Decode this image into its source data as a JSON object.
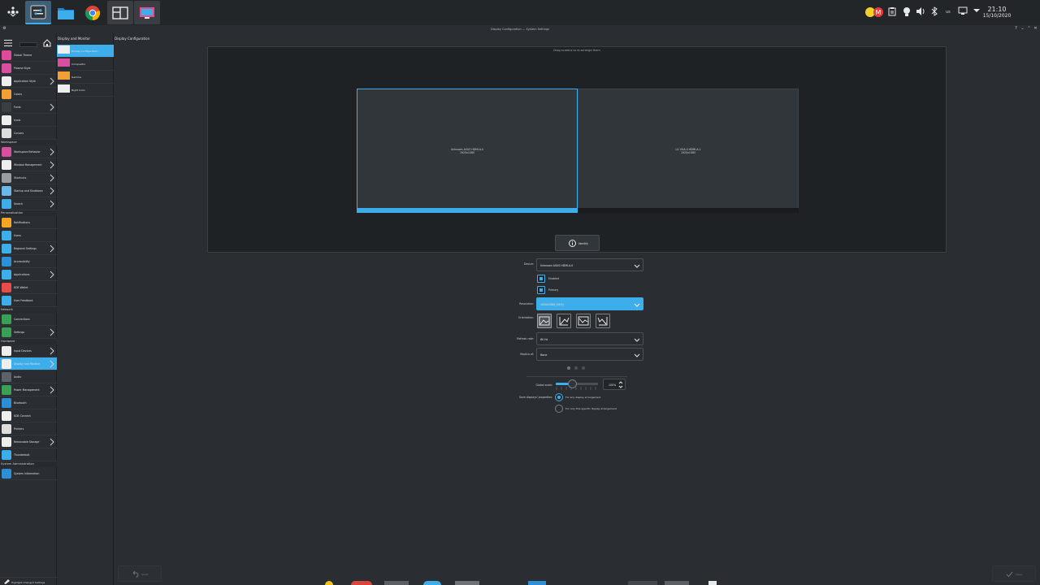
{
  "window": {
    "title": "Display Configuration — System Settings"
  },
  "panel": {
    "time": "21:10",
    "date": "15/10/2020",
    "keyboard_layout": "us",
    "notifications_badge": "M",
    "accent": "#3daee9"
  },
  "sidebar": {
    "items": [
      {
        "label": "Global Theme",
        "icon": "global-theme-icon",
        "chev": false,
        "color": "#e04a9a"
      },
      {
        "label": "Plasma Style",
        "icon": "plasma-style-icon",
        "chev": false,
        "color": "#d84fa0"
      },
      {
        "label": "Application Style",
        "icon": "application-style-icon",
        "chev": true,
        "color": "#eeeeee"
      },
      {
        "label": "Colors",
        "icon": "colors-icon",
        "chev": false,
        "color": "#f2a035"
      },
      {
        "label": "Fonts",
        "icon": "fonts-icon",
        "chev": true,
        "color": "#3a3f44"
      },
      {
        "label": "Icons",
        "icon": "icons-icon",
        "chev": false,
        "color": "#eeeeee"
      },
      {
        "label": "Cursors",
        "icon": "cursors-icon",
        "chev": false,
        "color": "#dddddd"
      }
    ],
    "sections": [
      {
        "title": "Workspace",
        "items": [
          {
            "label": "Workspace Behavior",
            "icon": "workspace-behavior-icon",
            "chev": true,
            "color": "#d84fa0"
          },
          {
            "label": "Window Management",
            "icon": "window-management-icon",
            "chev": true,
            "color": "#eeeeee"
          },
          {
            "label": "Shortcuts",
            "icon": "shortcuts-icon",
            "chev": true,
            "color": "#9a9ea2"
          },
          {
            "label": "Startup and Shutdown",
            "icon": "startup-shutdown-icon",
            "chev": true,
            "color": "#6cb8e8"
          },
          {
            "label": "Search",
            "icon": "search-icon",
            "chev": true,
            "color": "#3daee9"
          }
        ]
      },
      {
        "title": "Personalization",
        "items": [
          {
            "label": "Notifications",
            "icon": "notifications-icon",
            "chev": false,
            "color": "#f5a623"
          },
          {
            "label": "Users",
            "icon": "users-icon",
            "chev": false,
            "color": "#3daee9"
          },
          {
            "label": "Regional Settings",
            "icon": "regional-settings-icon",
            "chev": true,
            "color": "#3daee9"
          },
          {
            "label": "Accessibility",
            "icon": "accessibility-icon",
            "chev": false,
            "color": "#2d8fd5"
          },
          {
            "label": "Applications",
            "icon": "applications-icon",
            "chev": true,
            "color": "#3daee9"
          },
          {
            "label": "KDE Wallet",
            "icon": "kde-wallet-icon",
            "chev": false,
            "color": "#e84b4b"
          },
          {
            "label": "User Feedback",
            "icon": "user-feedback-icon",
            "chev": false,
            "color": "#3daee9"
          }
        ]
      },
      {
        "title": "Network",
        "items": [
          {
            "label": "Connections",
            "icon": "connections-icon",
            "chev": false,
            "color": "#3aa055"
          },
          {
            "label": "Settings",
            "icon": "network-settings-icon",
            "chev": true,
            "color": "#3aa055"
          }
        ]
      },
      {
        "title": "Hardware",
        "items": [
          {
            "label": "Input Devices",
            "icon": "input-devices-icon",
            "chev": true,
            "color": "#eeeeee"
          },
          {
            "label": "Display and Monitor",
            "icon": "display-monitor-icon",
            "chev": true,
            "color": "#eeeeee",
            "selected": true
          },
          {
            "label": "Audio",
            "icon": "audio-icon",
            "chev": false,
            "color": "#5d6268"
          },
          {
            "label": "Power Management",
            "icon": "power-management-icon",
            "chev": true,
            "color": "#3aa055"
          },
          {
            "label": "Bluetooth",
            "icon": "bluetooth-icon",
            "chev": false,
            "color": "#2d8fd5"
          },
          {
            "label": "KDE Connect",
            "icon": "kde-connect-icon",
            "chev": false,
            "color": "#eeeeee"
          },
          {
            "label": "Printers",
            "icon": "printers-icon",
            "chev": false,
            "color": "#dddddd"
          },
          {
            "label": "Removable Storage",
            "icon": "removable-storage-icon",
            "chev": true,
            "color": "#eeeeee"
          },
          {
            "label": "Thunderbolt",
            "icon": "thunderbolt-icon",
            "chev": false,
            "color": "#3daee9"
          }
        ]
      },
      {
        "title": "System Administration",
        "items": [
          {
            "label": "System Information",
            "icon": "system-information-icon",
            "chev": false,
            "color": "#2d8fd5"
          }
        ]
      }
    ],
    "footer": "Highlight Changed Settings"
  },
  "subcol": {
    "header": "Display and Monitor",
    "items": [
      {
        "label": "Display Configuration",
        "selected": true
      },
      {
        "label": "Compositor",
        "selected": false
      },
      {
        "label": "Gamma",
        "selected": false
      },
      {
        "label": "Night Color",
        "selected": false
      }
    ]
  },
  "main": {
    "page_title": "Display Configuration",
    "hint": "Drag screens to re-arrange them",
    "monitors": [
      {
        "name": "Unknown ASUS HDMI-A-0",
        "res": "1920x1080",
        "selected": true
      },
      {
        "name": "LG VGA-0 HDMI-A-1",
        "res": "1920x1080",
        "selected": false
      }
    ],
    "identify_label": "Identify",
    "device_label": "Device:",
    "device_value": "Unknown ASUS HDMI-A-0",
    "enabled_label": "Enabled",
    "primary_label": "Primary",
    "resolution_label": "Resolution:",
    "resolution_value": "1920x1080 (16:9)",
    "orientation_label": "Orientation:",
    "refresh_label": "Refresh rate:",
    "refresh_value": "60 Hz",
    "replica_label": "Replica of:",
    "replica_value": "None",
    "scale_label": "Global scale:",
    "scale_value": "100%",
    "scale_fraction": 0.38,
    "save_label": "Save displays' properties:",
    "radio_global": "For any display arrangement",
    "radio_specific": "For only this specific display arrangement",
    "reset_label": "Reset",
    "apply_label": "Apply"
  }
}
